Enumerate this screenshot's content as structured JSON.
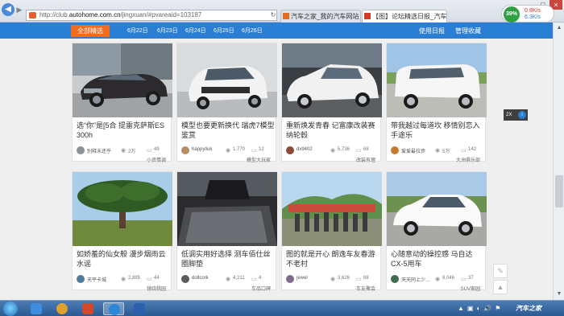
{
  "browser": {
    "address_url_prefix": "http://club.",
    "address_url_host": "autohome.com.cn",
    "address_url_path": "/jingxuan/#pvareaid=103187",
    "tabs": [
      {
        "label": "汽车之家_我的汽车网站，我的..."
      },
      {
        "label": "【图】论坛精选日报_汽车..."
      }
    ],
    "speed_percent": "39%",
    "speed_up": "0.8K/s",
    "speed_down": "6.3K/s"
  },
  "topbar": {
    "active": "全部精选",
    "dates": [
      "6月22日",
      "6月23日",
      "6月24日",
      "6月25日",
      "6月26日"
    ],
    "right_links": [
      "使用日报",
      "管理收藏"
    ]
  },
  "cards": [
    {
      "title": "选“你”是[5合 提雷克萨斯ES 300h",
      "user": "别释未还乎",
      "views": "2万",
      "comments": "49",
      "tag": "小资情调",
      "avatar_color": "#6d7f8f",
      "thumb": "lexus"
    },
    {
      "title": "模型也要更新换代 瑞虎7模型鉴赏",
      "user": "happyliuk",
      "views": "1,770",
      "comments": "12",
      "tag": "模型大玩家",
      "avatar_color": "#b68c62",
      "thumb": "suv-white"
    },
    {
      "title": "重新焕发青春 记富康改装赛纳轮毂",
      "user": "dx9402",
      "views": "5,736",
      "comments": "68",
      "tag": "改装有理",
      "avatar_color": "#8c4b3a",
      "thumb": "sedan-old"
    },
    {
      "title": "带我越过每道坎 移情别恋入手途乐",
      "user": "爱爱最拉步",
      "views": "5万",
      "comments": "142",
      "tag": "大洲俱乐部",
      "avatar_color": "#c77b30",
      "thumb": "patrol"
    },
    {
      "title": "如娇羞的仙女般 漫步烟雨云水谣",
      "user": "天平卡城",
      "views": "2,885",
      "comments": "44",
      "tag": "镜绕桃园",
      "avatar_color": "#4f7b9a",
      "thumb": "tree"
    },
    {
      "title": "低调实用好选择 测车佰仕丝圈脚垫",
      "user": "dollcork",
      "views": "4,211",
      "comments": "4",
      "tag": "车品口碑",
      "avatar_color": "#5b5b5b",
      "thumb": "interior"
    },
    {
      "title": "图的就是开心 朗逸车友春游不老村",
      "user": "jewel",
      "views": "3,626",
      "comments": "88",
      "tag": "车友聚会",
      "avatar_color": "#7d6c8a",
      "thumb": "group"
    },
    {
      "title": "心随意动的操控感 马自达CX-5用车",
      "user": "天天同上少…",
      "views": "8,046",
      "comments": "37",
      "tag": "SUV家园",
      "avatar_color": "#3f6e4f",
      "thumb": "cx5"
    }
  ],
  "side_float": {
    "label": "2X",
    "info_icon": "i"
  },
  "icons": {
    "nav_back": "arrow-left-icon",
    "eye": "eye-icon",
    "comment": "comment-icon"
  },
  "taskbar": {
    "tray_icons": [
      "▲",
      "▣",
      "◐",
      "🔊",
      "⚑"
    ],
    "watermark": "汽车之家"
  },
  "colors": {
    "accent_blue": "#2a7ed3",
    "accent_orange": "#f26c1f"
  }
}
